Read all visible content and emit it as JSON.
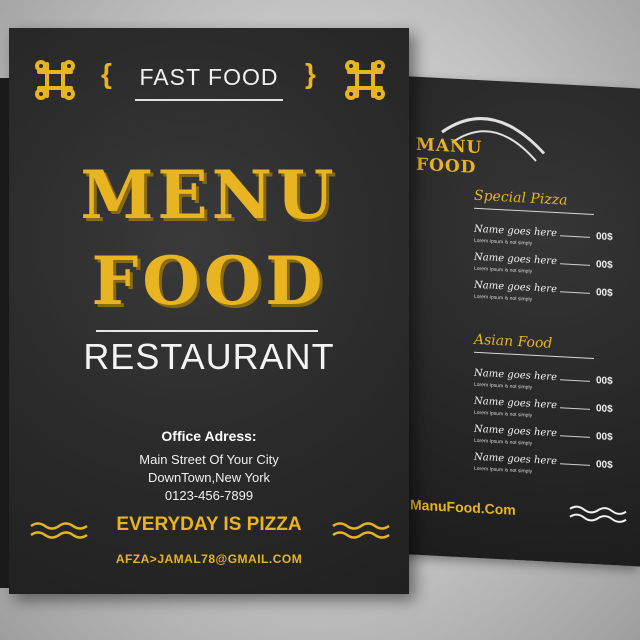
{
  "front": {
    "fast_food": "FAST FOOD",
    "title_line1": "MENU",
    "title_line2": "FOOD",
    "subtitle": "RESTAURANT",
    "office_heading": "Office Adress:",
    "address_line1": "Main Street Of Your City",
    "address_line2": "DownTown,New York",
    "phone": "0123-456-7899",
    "slogan": "EVERYDAY IS PIZZA",
    "email": "AFZA>JAMAL78@GMAIL.COM"
  },
  "back": {
    "title_line1": "MANU",
    "title_line2": "FOOD",
    "sections": [
      {
        "name": "Special Pizza",
        "items": [
          {
            "name": "Name goes here",
            "sub": "Lorem Ipsum is not simply",
            "price": "00$"
          },
          {
            "name": "Name goes here",
            "sub": "Lorem Ipsum is not simply",
            "price": "00$"
          },
          {
            "name": "Name goes here",
            "sub": "Lorem Ipsum is not simply",
            "price": "00$"
          }
        ]
      },
      {
        "name": "Asian Food",
        "items": [
          {
            "name": "Name goes here",
            "sub": "Lorem Ipsum is not simply",
            "price": "00$"
          },
          {
            "name": "Name goes here",
            "sub": "Lorem Ipsum is not simply",
            "price": "00$"
          },
          {
            "name": "Name goes here",
            "sub": "Lorem Ipsum is not simply",
            "price": "00$"
          },
          {
            "name": "Name goes here",
            "sub": "Lorem Ipsum is not simply",
            "price": "00$"
          }
        ]
      }
    ],
    "website": "ManuFood.Com"
  },
  "colors": {
    "accent": "#e8b422",
    "board": "#2b2b2b",
    "text": "#f2f2f2"
  },
  "icons": [
    "ornament-knot-icon",
    "left-brace-icon",
    "right-brace-icon",
    "wave-decoration-icon"
  ]
}
